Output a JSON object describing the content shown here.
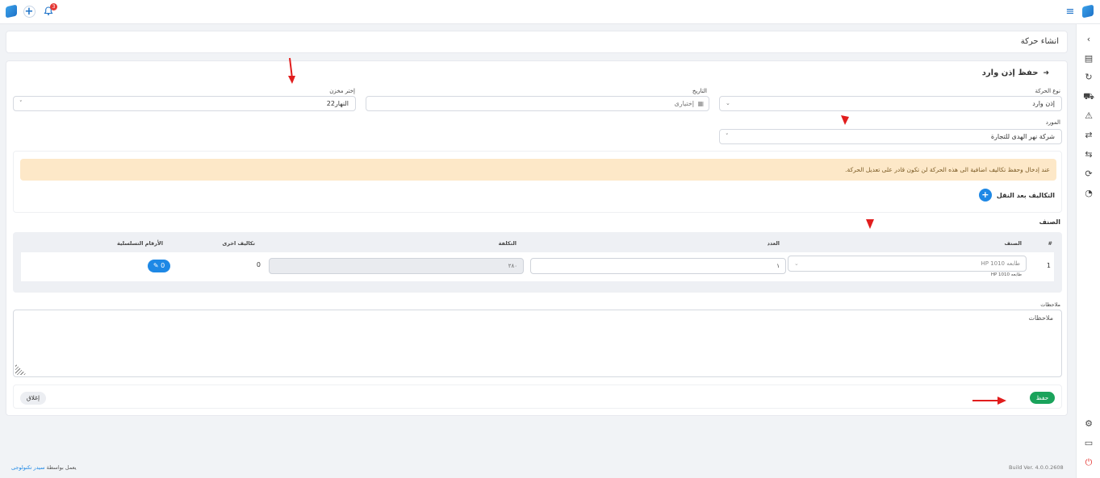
{
  "topbar": {
    "notification_count": "3"
  },
  "page": {
    "title": "انشاء حركة"
  },
  "form": {
    "title": "حفظ إذن وارد",
    "movement_type_label": "نوع الحركة",
    "movement_type_value": "إذن وارد",
    "date_label": "التاريخ",
    "date_placeholder": "إختيارى",
    "warehouse_label": "إختر مخزن",
    "warehouse_value": "النهار22",
    "supplier_label": "المورد",
    "supplier_value": "شركة نهر الهدى للتجارة"
  },
  "alert": {
    "text": "عند إدخال وحفظ تكاليف اضافية الى هذه الحركة لن تكون قادر على تعديل الحركة."
  },
  "costs": {
    "label": "التكاليف بعد النقل",
    "add_symbol": "+"
  },
  "items": {
    "section_title": "الصنف",
    "headers": {
      "index": "#",
      "item": "الصنف",
      "quantity": "العدد",
      "cost": "التكلفة",
      "extra_cost": "تكاليف اخرى",
      "serials": "الأرقام التسلسلية"
    },
    "rows": [
      {
        "index": "1",
        "item_value": "طابعه HP 1010",
        "item_sub": "طابعه HP 1010",
        "quantity": "١",
        "cost": "٢٨٠",
        "extra_cost": "0",
        "serial_count": "0"
      }
    ]
  },
  "notes": {
    "label": "ملاحظات",
    "placeholder": "ملاحظات"
  },
  "actions": {
    "save": "حفظ",
    "close": "إغلاق"
  },
  "footer": {
    "powered_prefix": "يعمل بواسطة",
    "powered_brand": "سيدر تكنولوجى",
    "build": "Build Ver. 4.0.0.2608"
  },
  "colors": {
    "primary": "#1e88e5",
    "success": "#1aa35b",
    "warning_bg": "#fde8c8",
    "annotation_arrow": "#e11d1d"
  }
}
